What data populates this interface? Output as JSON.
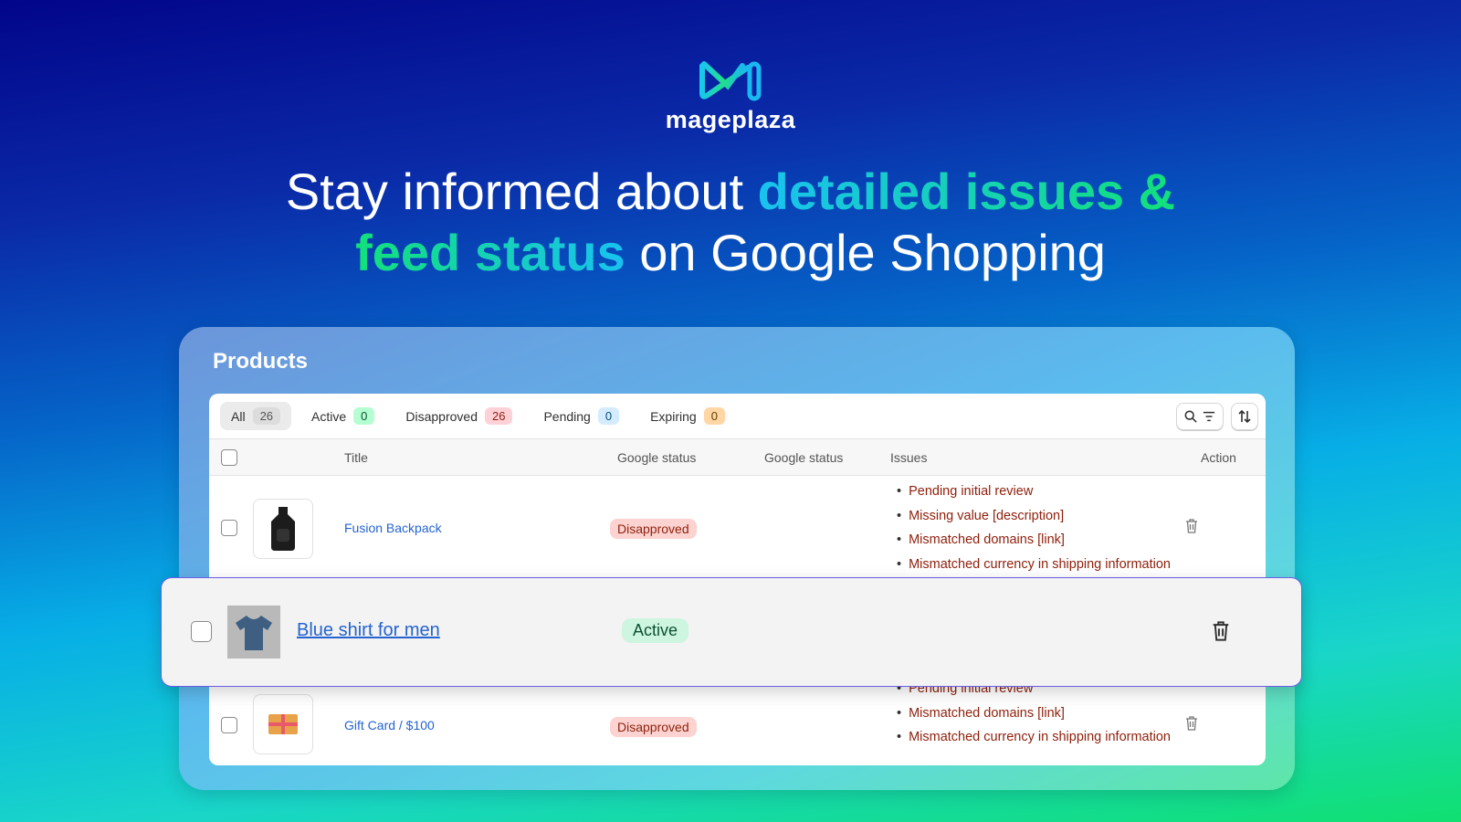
{
  "brand": {
    "name": "mageplaza"
  },
  "headline": {
    "part1": "Stay informed about ",
    "highlight1": "detailed issues &",
    "highlight2": "feed status",
    "part2": " on Google Shopping"
  },
  "products": {
    "title": "Products",
    "tabs": [
      {
        "label": "All",
        "count": "26",
        "color": "#e3e3e3"
      },
      {
        "label": "Active",
        "count": "0",
        "color": "#b4fed2"
      },
      {
        "label": "Disapproved",
        "count": "26",
        "color": "#fed1d7"
      },
      {
        "label": "Pending",
        "count": "0",
        "color": "#d5ebff"
      },
      {
        "label": "Expiring",
        "count": "0",
        "color": "#ffd6a4"
      }
    ],
    "columns": [
      "Title",
      "Google status",
      "Google status",
      "Issues",
      "Action"
    ],
    "rows": [
      {
        "title": "Fusion Backpack",
        "status": "Disapproved",
        "issues": [
          "Pending initial review",
          "Missing value [description]",
          "Mismatched domains [link]",
          "Mismatched currency in shipping information"
        ]
      },
      {
        "title": "Blue shirt for men",
        "status": "Active",
        "issues": []
      },
      {
        "title": "Gift Card / $100",
        "status": "Disapproved",
        "issues": [
          "Pending initial review",
          "Mismatched domains [link]",
          "Mismatched currency in shipping information"
        ]
      }
    ]
  },
  "icons": {
    "search": "search-icon",
    "filter": "filter-icon",
    "sort": "sort-icon",
    "delete": "trash-icon"
  }
}
